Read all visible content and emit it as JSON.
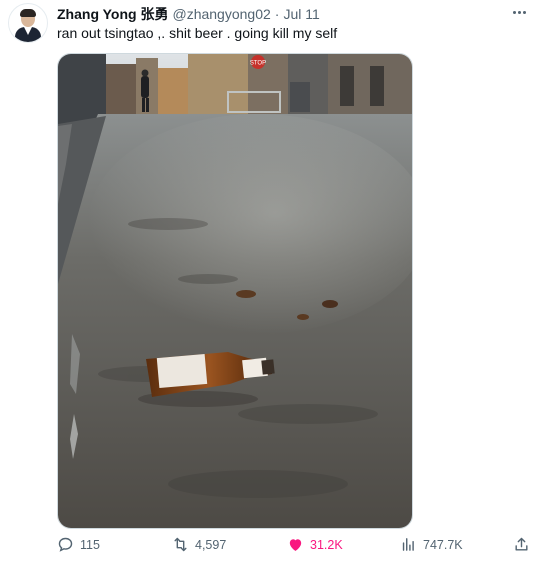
{
  "tweet": {
    "author_name": "Zhang Yong 张勇",
    "handle": "@zhangyong02",
    "separator": "·",
    "date": "Jul 11",
    "text": "ran out tsingtao ,. shit beer . going kill my self"
  },
  "media": {
    "sign_text": "STOP"
  },
  "actions": {
    "replies": "115",
    "retweets": "4,597",
    "likes": "31.2K",
    "views": "747.7K"
  },
  "colors": {
    "text": "#0f1419",
    "muted": "#536471",
    "like": "#f91880"
  },
  "icons": [
    "more-icon",
    "reply-icon",
    "retweet-icon",
    "like-icon",
    "views-icon",
    "share-icon"
  ]
}
